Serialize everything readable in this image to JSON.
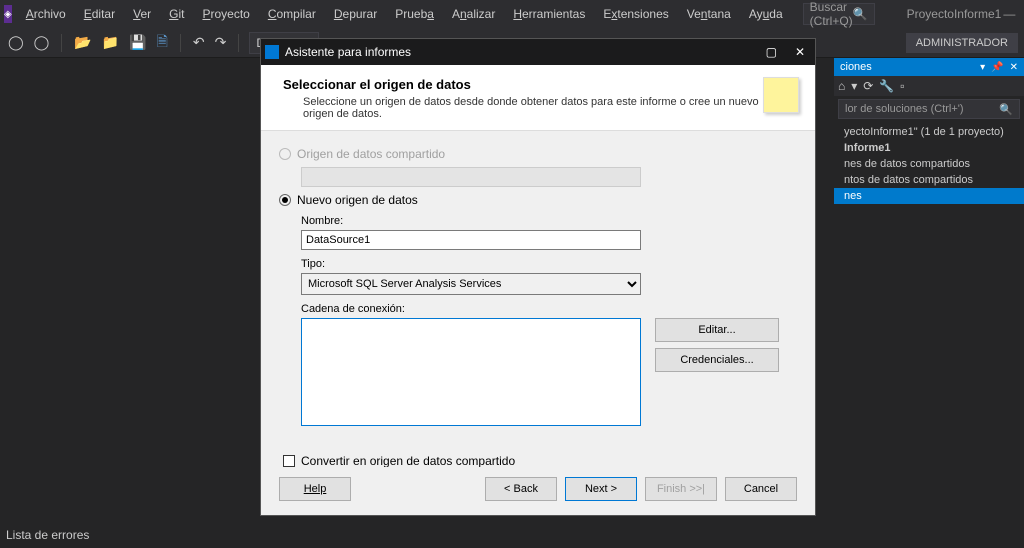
{
  "menubar": {
    "items": [
      "Archivo",
      "Editar",
      "Ver",
      "Git",
      "Proyecto",
      "Compilar",
      "Depurar",
      "Prueba",
      "Analizar",
      "Herramientas",
      "Extensiones",
      "Ventana",
      "Ayuda"
    ],
    "search_placeholder": "Buscar (Ctrl+Q)",
    "project_name": "ProyectoInforme1"
  },
  "toolbar": {
    "config": "Debug",
    "admin": "ADMINISTRADOR"
  },
  "dialog": {
    "window_title": "Asistente para informes",
    "header_title": "Seleccionar el origen de datos",
    "header_sub": "Seleccione un origen de datos desde donde obtener datos para este informe o cree un nuevo origen de datos.",
    "shared_label": "Origen de datos compartido",
    "newds_label": "Nuevo origen de datos",
    "name_label": "Nombre:",
    "name_value": "DataSource1",
    "type_label": "Tipo:",
    "type_value": "Microsoft SQL Server Analysis Services",
    "conn_label": "Cadena de conexión:",
    "conn_value": "",
    "edit_btn": "Editar...",
    "cred_btn": "Credenciales...",
    "convert_label": "Convertir en origen de datos compartido",
    "help": "Help",
    "back": "< Back",
    "next": "Next >",
    "finish": "Finish >>|",
    "cancel": "Cancel"
  },
  "panel": {
    "title": "ciones",
    "search_placeholder": "lor de soluciones (Ctrl+')",
    "items": [
      "yectoInforme1\" (1 de 1 proyecto)",
      "Informe1",
      "nes de datos compartidos",
      "ntos de datos compartidos",
      "nes"
    ]
  },
  "errors": "Lista de errores"
}
